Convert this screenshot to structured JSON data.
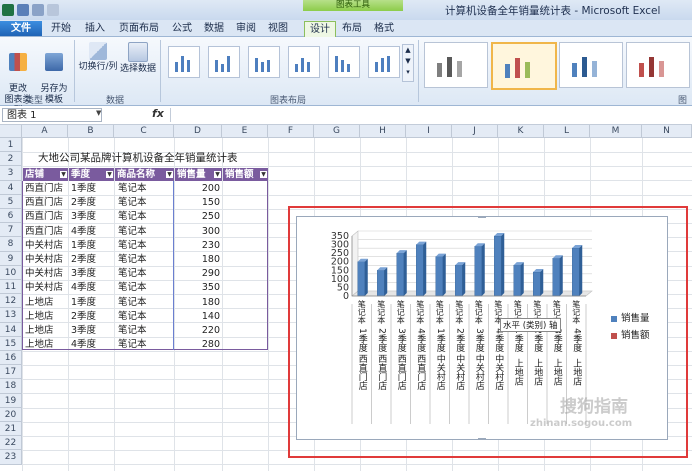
{
  "window": {
    "title": "计算机设备全年销量统计表 - Microsoft Excel",
    "context_group": "图表工具"
  },
  "tabs": [
    "文件",
    "开始",
    "插入",
    "页面布局",
    "公式",
    "数据",
    "审阅",
    "视图",
    "设计",
    "布局",
    "格式"
  ],
  "ribbon": {
    "type_group": {
      "label": "类型",
      "change_type": "更改\n图表类型",
      "save_template": "另存为\n模板"
    },
    "data_group": {
      "label": "数据",
      "switch_rowcol": "切换行/列",
      "select_data": "选择数据"
    },
    "layout_group": {
      "label": "图表布局"
    },
    "style_group": {
      "label": "图表"
    }
  },
  "formula_bar": {
    "name_box": "图表 1",
    "fx": "fx"
  },
  "columns": [
    "A",
    "B",
    "C",
    "D",
    "E",
    "F",
    "G",
    "H",
    "I",
    "J",
    "K",
    "L",
    "M",
    "N"
  ],
  "rows": [
    "1",
    "2",
    "3",
    "4",
    "5",
    "6",
    "7",
    "8",
    "9",
    "10",
    "11",
    "12",
    "13",
    "14",
    "15",
    "16",
    "17",
    "18",
    "19",
    "20",
    "21",
    "22",
    "23"
  ],
  "sheet": {
    "title": "大地公司某品牌计算机设备全年销量统计表",
    "headers": [
      "店铺",
      "季度",
      "商品名称",
      "销售量",
      "销售额"
    ],
    "table": [
      [
        "西直门店",
        "1季度",
        "笔记本",
        "200"
      ],
      [
        "西直门店",
        "2季度",
        "笔记本",
        "150"
      ],
      [
        "西直门店",
        "3季度",
        "笔记本",
        "250"
      ],
      [
        "西直门店",
        "4季度",
        "笔记本",
        "300"
      ],
      [
        "中关村店",
        "1季度",
        "笔记本",
        "230"
      ],
      [
        "中关村店",
        "2季度",
        "笔记本",
        "180"
      ],
      [
        "中关村店",
        "3季度",
        "笔记本",
        "290"
      ],
      [
        "中关村店",
        "4季度",
        "笔记本",
        "350"
      ],
      [
        "上地店",
        "1季度",
        "笔记本",
        "180"
      ],
      [
        "上地店",
        "2季度",
        "笔记本",
        "140"
      ],
      [
        "上地店",
        "3季度",
        "笔记本",
        "220"
      ],
      [
        "上地店",
        "4季度",
        "笔记本",
        "280"
      ]
    ]
  },
  "chart_data": {
    "type": "bar",
    "yticks": [
      "0",
      "50",
      "100",
      "150",
      "200",
      "250",
      "300",
      "350"
    ],
    "ylim": [
      0,
      350
    ],
    "cat_word": "笔记本",
    "cat_quarters": [
      "1季度",
      "2季度",
      "3季度",
      "4季度",
      "1季度",
      "2季度",
      "3季度",
      "4季度",
      "1季度",
      "2季度",
      "3季度",
      "4季度"
    ],
    "cat_stores": [
      "西直门店",
      "西直门店",
      "西直门店",
      "西直门店",
      "中关村店",
      "中关村店",
      "中关村店",
      "中关村店",
      "上地店",
      "上地店",
      "上地店",
      "上地店"
    ],
    "series": [
      {
        "name": "销售量",
        "values": [
          200,
          150,
          250,
          300,
          230,
          180,
          290,
          350,
          180,
          140,
          220,
          280
        ]
      },
      {
        "name": "销售额",
        "values": [
          0,
          0,
          0,
          0,
          0,
          0,
          0,
          0,
          0,
          0,
          0,
          0
        ]
      }
    ],
    "legend_position": "right",
    "colors": {
      "s1": "#4f81bd",
      "s2": "#c0504d"
    },
    "axis_tooltip": "水平 (类别) 轴"
  },
  "watermark": {
    "cn": "搜狗指南",
    "en": "zhinan.sogou.com"
  }
}
